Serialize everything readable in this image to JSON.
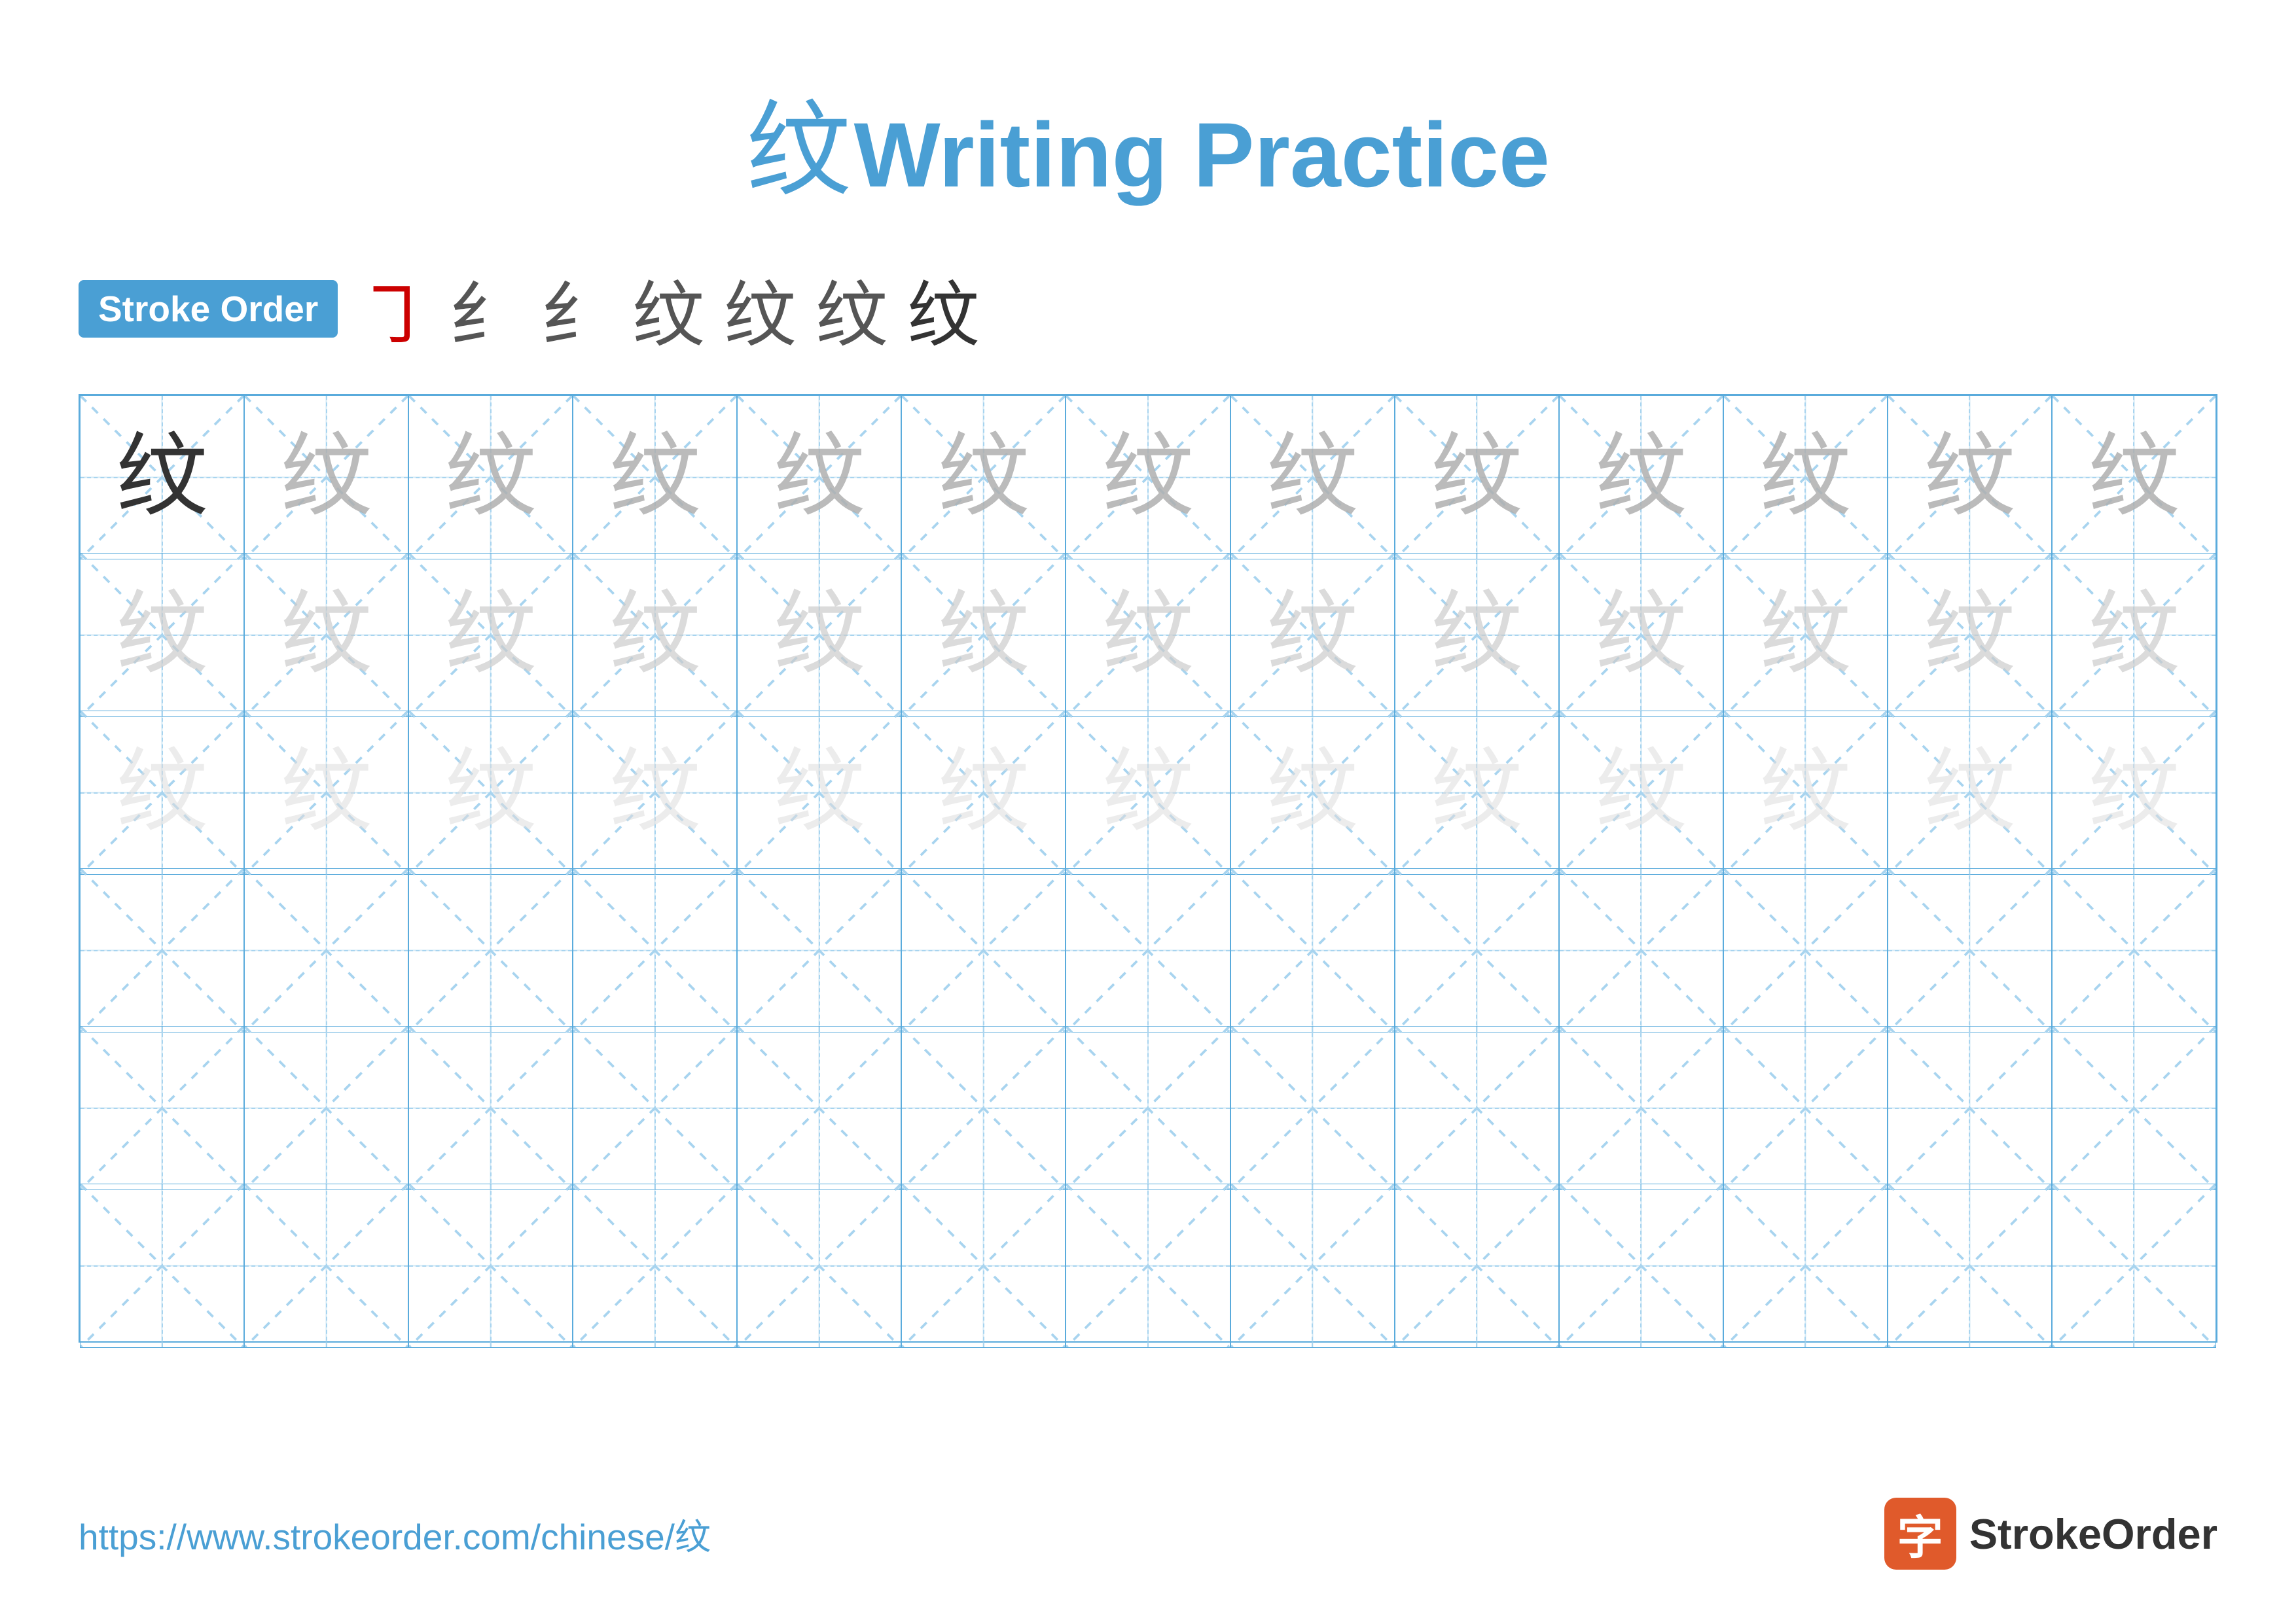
{
  "title": {
    "char": "纹",
    "text": "Writing Practice"
  },
  "stroke_order": {
    "badge_label": "Stroke Order",
    "steps": [
      "㇆",
      "纟",
      "纟",
      "纹",
      "纹",
      "纹",
      "纹"
    ]
  },
  "grid": {
    "rows": 6,
    "cols": 13,
    "character": "纹",
    "row_styles": [
      [
        "solid",
        "medium-gray",
        "medium-gray",
        "medium-gray",
        "medium-gray",
        "medium-gray",
        "medium-gray",
        "medium-gray",
        "medium-gray",
        "medium-gray",
        "medium-gray",
        "medium-gray",
        "medium-gray"
      ],
      [
        "light-gray",
        "light-gray",
        "light-gray",
        "light-gray",
        "light-gray",
        "light-gray",
        "light-gray",
        "light-gray",
        "light-gray",
        "light-gray",
        "light-gray",
        "light-gray",
        "light-gray"
      ],
      [
        "very-light",
        "very-light",
        "very-light",
        "very-light",
        "very-light",
        "very-light",
        "very-light",
        "very-light",
        "very-light",
        "very-light",
        "very-light",
        "very-light",
        "very-light"
      ],
      [
        "",
        "",
        "",
        "",
        "",
        "",
        "",
        "",
        "",
        "",
        "",
        "",
        ""
      ],
      [
        "",
        "",
        "",
        "",
        "",
        "",
        "",
        "",
        "",
        "",
        "",
        "",
        ""
      ],
      [
        "",
        "",
        "",
        "",
        "",
        "",
        "",
        "",
        "",
        "",
        "",
        "",
        ""
      ]
    ]
  },
  "footer": {
    "url": "https://www.strokeorder.com/chinese/纹",
    "logo_char": "字",
    "logo_text": "StrokeOrder"
  }
}
